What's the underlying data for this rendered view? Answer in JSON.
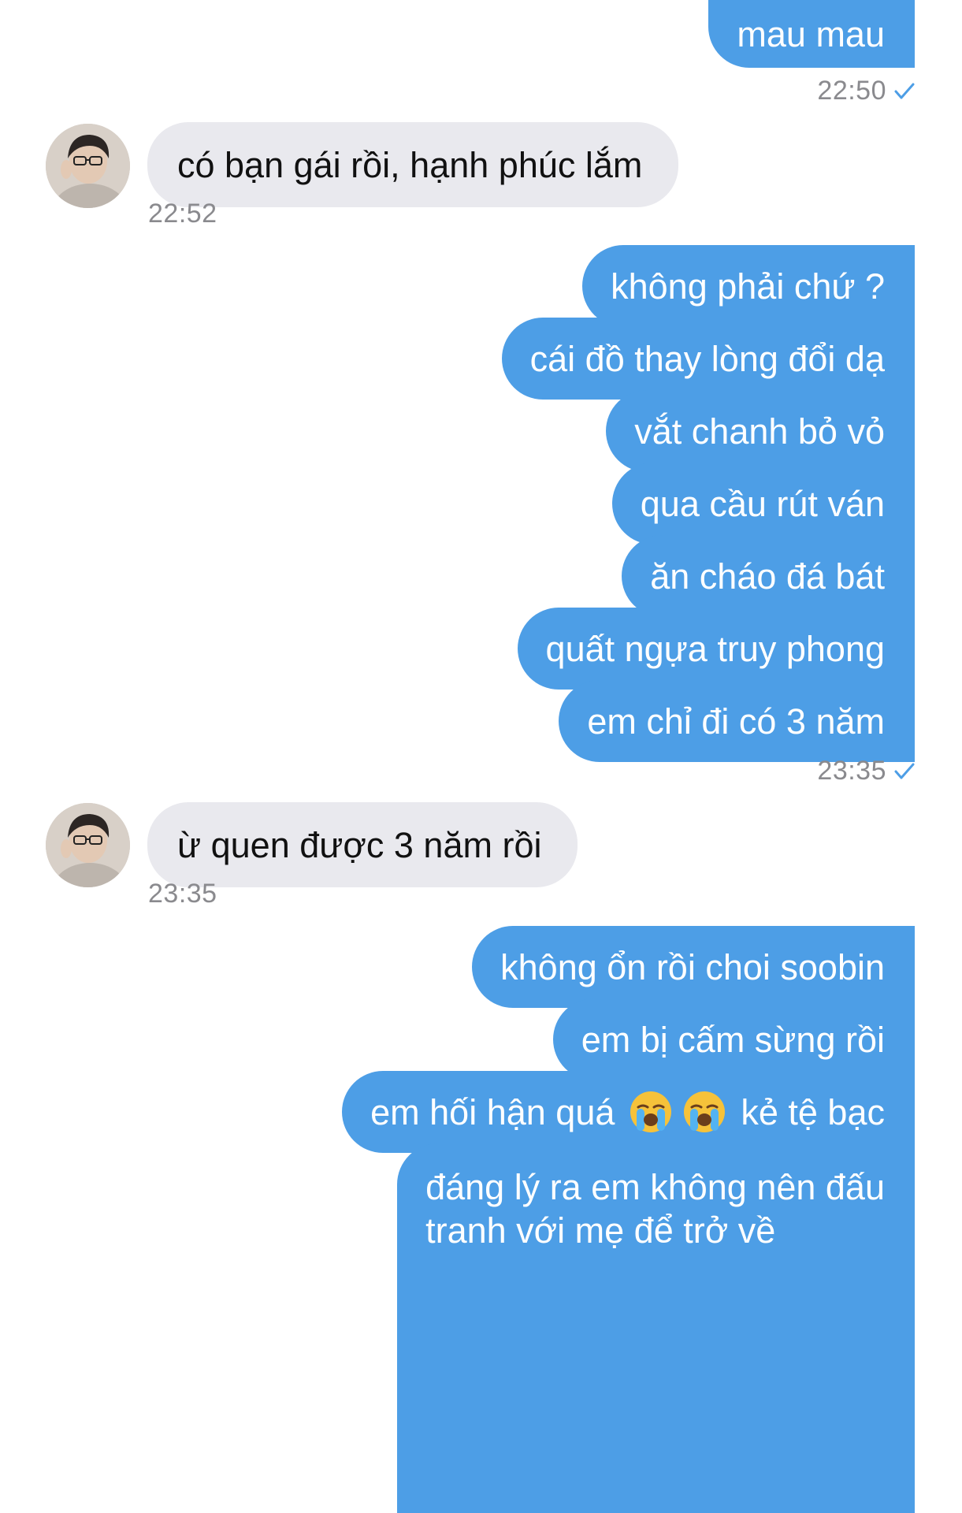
{
  "messages": {
    "m1": "mau mau",
    "t1": "22:50",
    "m2": "có bạn gái rồi, hạnh phúc lắm",
    "t2": "22:52",
    "m3": "không phải chứ ?",
    "m4": "cái đồ thay lòng đổi dạ",
    "m5": "vắt chanh bỏ vỏ",
    "m6": "qua cầu rút ván",
    "m7": "ăn cháo đá bát",
    "m8": "quất ngựa truy phong",
    "m9": "em chỉ đi có 3 năm",
    "t3": "23:35",
    "m10": "ừ quen được 3 năm rồi",
    "t4": "23:35",
    "m11": "không ổn rồi choi soobin",
    "m12": "em bị cấm sừng rồi",
    "m13a": "em hối hận quá",
    "m13b": "kẻ tệ bạc",
    "m14a": "đáng lý ra em không nên đấu",
    "m14b": "tranh với mẹ để trở về"
  },
  "icons": {
    "read_check": "checkmark-icon",
    "emoji": "loudly-crying-face-emoji",
    "avatar": "contact-avatar"
  },
  "colors": {
    "outgoing_bubble": "#4d9ee6",
    "incoming_bubble": "#e9e9ee",
    "timestamp": "#8a8a8e",
    "check": "#4d9ee6"
  }
}
